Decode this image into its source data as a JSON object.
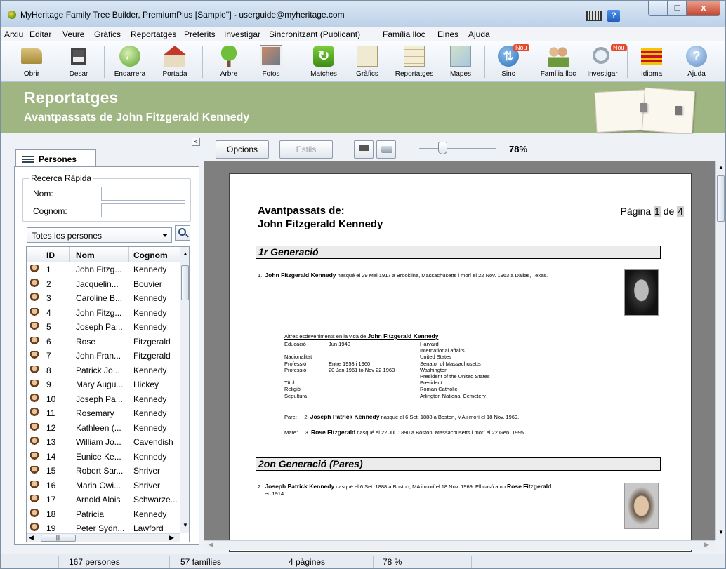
{
  "window": {
    "title": "MyHeritage Family Tree Builder, PremiumPlus [Sample''] - userguide@myheritage.com"
  },
  "menu": [
    "Arxiu",
    "Editar",
    "Veure",
    "Gràfics",
    "Reportatges",
    "Preferits",
    "Investigar",
    "Sincronitzant (Publicant)",
    "Família lloc",
    "Eines",
    "Ajuda"
  ],
  "toolbar": {
    "items": [
      {
        "label": "Obrir",
        "icon": "folder-icon"
      },
      {
        "label": "Desar",
        "icon": "save-icon"
      },
      {
        "label": "Endarrera",
        "icon": "back-arrow-icon"
      },
      {
        "label": "Portada",
        "icon": "home-icon"
      },
      {
        "label": "Arbre",
        "icon": "tree-icon"
      },
      {
        "label": "Fotos",
        "icon": "photos-icon"
      },
      {
        "label": "Matches",
        "icon": "matches-icon"
      },
      {
        "label": "Gràfics",
        "icon": "charts-icon"
      },
      {
        "label": "Reportatges",
        "icon": "reports-icon"
      },
      {
        "label": "Mapes",
        "icon": "map-icon"
      },
      {
        "label": "Sinc",
        "icon": "sync-icon"
      },
      {
        "label": "Família lloc",
        "icon": "family-site-icon"
      },
      {
        "label": "Investigar",
        "icon": "research-icon"
      },
      {
        "label": "Idioma",
        "icon": "language-flag-icon"
      },
      {
        "label": "Ajuda",
        "icon": "help-icon"
      }
    ],
    "badge": "Nou"
  },
  "banner": {
    "title": "Reportatges",
    "subtitle": "Avantpassats de John Fitzgerald Kennedy"
  },
  "left": {
    "tab": "Persones",
    "quick_search": "Recerca Ràpida",
    "name_label": "Nom:",
    "surname_label": "Cognom:",
    "filter": "Totes les persones",
    "columns": [
      "ID",
      "Nom",
      "Cognom"
    ],
    "rows": [
      [
        "1",
        "John Fitzg...",
        "Kennedy"
      ],
      [
        "2",
        "Jacquelin...",
        "Bouvier"
      ],
      [
        "3",
        "Caroline B...",
        "Kennedy"
      ],
      [
        "4",
        "John Fitzg...",
        "Kennedy"
      ],
      [
        "5",
        "Joseph Pa...",
        "Kennedy"
      ],
      [
        "6",
        "Rose",
        "Fitzgerald"
      ],
      [
        "7",
        "John Fran...",
        "Fitzgerald"
      ],
      [
        "8",
        "Patrick Jo...",
        "Kennedy"
      ],
      [
        "9",
        "Mary Augu...",
        "Hickey"
      ],
      [
        "10",
        "Joseph Pa...",
        "Kennedy"
      ],
      [
        "11",
        "Rosemary",
        "Kennedy"
      ],
      [
        "12",
        "Kathleen (...",
        "Kennedy"
      ],
      [
        "13",
        "William Jo...",
        "Cavendish"
      ],
      [
        "14",
        "Eunice Ke...",
        "Kennedy"
      ],
      [
        "15",
        "Robert Sar...",
        "Shriver"
      ],
      [
        "16",
        "Maria Owi...",
        "Shriver"
      ],
      [
        "17",
        "Arnold Alois",
        "Schwarze..."
      ],
      [
        "18",
        "Patricia",
        "Kennedy"
      ],
      [
        "19",
        "Peter Sydn...",
        "Lawford"
      ]
    ]
  },
  "report_toolbar": {
    "options": "Opcions",
    "styles": "Estils",
    "zoom": "78%"
  },
  "report": {
    "title_line1": "Avantpassats de:",
    "title_line2": "John Fitzgerald Kennedy",
    "page_word": "Pàgina",
    "page_current": "1",
    "page_of": "de",
    "page_total": "4",
    "gen1": "1r Generació",
    "gen2": "2on Generació (Pares)",
    "p1_num": "1.",
    "p1_name": "John Fitzgerald Kennedy",
    "p1_text": " nasqué el 29 Mai 1917 a Brookline, Massachusetts i morí el 22 Nov. 1963 a Dallas, Texas.",
    "events_prefix": "Altres esdeveniments en la vida de ",
    "events_name": "John Fitzgerald Kennedy",
    "events": [
      [
        "Educació",
        "Jun 1940",
        "Harvard"
      ],
      [
        "",
        "",
        "International affairs"
      ],
      [
        "Nacionalitat",
        "",
        "United States"
      ],
      [
        "Professió",
        "Entre 1953 i 1960",
        "Senator of Massachusetts"
      ],
      [
        "Professió",
        "20 Jan 1961 to Nov 22 1963",
        "Washington"
      ],
      [
        "",
        "",
        "President of the United States"
      ],
      [
        "Títol",
        "",
        "President"
      ],
      [
        "Religió",
        "",
        "Roman Catholic"
      ],
      [
        "Sepultura",
        "",
        "Arlington National Cemetery"
      ]
    ],
    "father_label": "Pare:",
    "father_num": "2.",
    "father_name": "Joseph Patrick Kennedy",
    "father_text": " nasqué el 6 Set. 1888 a Boston, MA i morí el 18 Nov. 1969.",
    "mother_label": "Mare:",
    "mother_num": "3.",
    "mother_name": "Rose Fitzgerald",
    "mother_text": " nasqué el 22 Jul. 1890 a Boston, Massachusetts i morí el 22 Gen. 1995.",
    "p2_num": "2.",
    "p2_name": "Joseph Patrick Kennedy",
    "p2_text": " nasqué el 6 Set. 1888 a Boston, MA i morí el 18 Nov. 1969. Ell casó amb ",
    "p2_spouse": "Rose Fitzgerald",
    "p2_text2": " en 1914."
  },
  "status": {
    "persons": "167 persones",
    "families": "57 famílies",
    "pages": "4 pàgines",
    "zoom": "78 %"
  }
}
